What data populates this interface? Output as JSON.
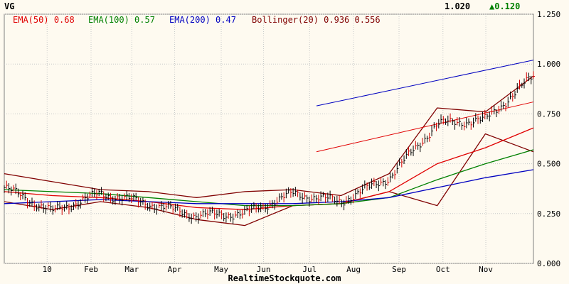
{
  "header": {
    "symbol": "VG",
    "last_price": "1.020",
    "change": "0.120",
    "change_arrow_color": "#008000"
  },
  "legend": [
    {
      "label": "EMA(50)",
      "value": "0.68",
      "color": "#e00000"
    },
    {
      "label": "EMA(100)",
      "value": "0.57",
      "color": "#008000"
    },
    {
      "label": "EMA(200)",
      "value": "0.47",
      "color": "#0000c0"
    },
    {
      "label": "Bollinger(20)",
      "value": "0.936 0.556",
      "color": "#800000"
    }
  ],
  "footer": "RealtimeStockquote.com",
  "chart_data": {
    "type": "line",
    "title": "VG",
    "x_labels": [
      "10",
      "Feb",
      "Mar",
      "Apr",
      "May",
      "Jun",
      "Jul",
      "Aug",
      "Sep",
      "Oct",
      "Nov"
    ],
    "y_ticks": [
      "1.250",
      "1.000",
      "0.750",
      "0.500",
      "0.250",
      "0.000"
    ],
    "ylim": [
      0,
      1.25
    ],
    "grid": true,
    "price_bars": {
      "x": [
        "10",
        "Feb",
        "Mar",
        "Apr",
        "May",
        "Jun",
        "Jul",
        "Aug",
        "Sep",
        "Oct",
        "Nov"
      ],
      "close": [
        0.38,
        0.26,
        0.35,
        0.3,
        0.24,
        0.25,
        0.35,
        0.31,
        0.43,
        0.7,
        0.72,
        0.94
      ]
    },
    "series": [
      {
        "name": "EMA(50)",
        "color": "#e00000",
        "values": [
          0.36,
          0.34,
          0.33,
          0.31,
          0.28,
          0.27,
          0.29,
          0.3,
          0.36,
          0.5,
          0.58,
          0.68
        ]
      },
      {
        "name": "EMA(100)",
        "color": "#008000",
        "values": [
          0.37,
          0.36,
          0.35,
          0.33,
          0.31,
          0.29,
          0.29,
          0.3,
          0.33,
          0.42,
          0.5,
          0.57
        ]
      },
      {
        "name": "EMA(200)",
        "color": "#0000c0",
        "values": [
          0.3,
          0.31,
          0.32,
          0.31,
          0.3,
          0.3,
          0.3,
          0.31,
          0.33,
          0.38,
          0.43,
          0.47
        ]
      }
    ],
    "bollinger": {
      "upper": [
        0.45,
        0.41,
        0.37,
        0.36,
        0.33,
        0.36,
        0.37,
        0.34,
        0.45,
        0.78,
        0.76,
        0.94
      ],
      "lower": [
        0.31,
        0.27,
        0.31,
        0.28,
        0.22,
        0.19,
        0.29,
        0.3,
        0.36,
        0.29,
        0.65,
        0.56
      ]
    },
    "trend_lines": [
      {
        "color": "#0000c0",
        "from": [
          0.59,
          0.79
        ],
        "to": [
          1.0,
          1.02
        ]
      },
      {
        "color": "#e00000",
        "from": [
          0.59,
          0.56
        ],
        "to": [
          1.0,
          0.81
        ]
      }
    ]
  }
}
